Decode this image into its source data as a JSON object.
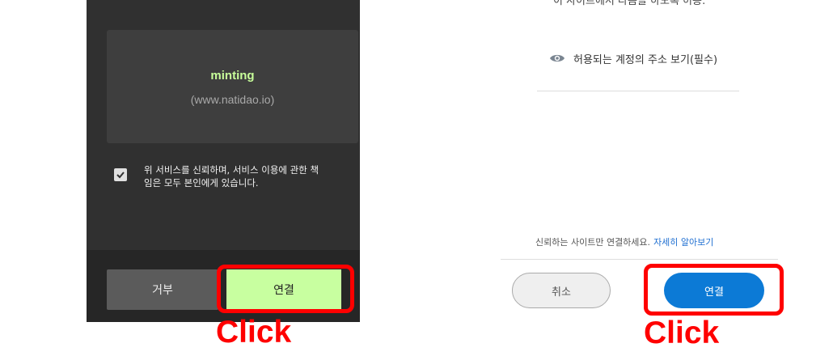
{
  "left_wallet": {
    "site_name": "minting",
    "site_url": "(www.natidao.io)",
    "consent_line1": "위 서비스를 신뢰하며, 서비스 이용에 관한 책",
    "consent_line2": "임은 모두 본인에게 있습니다.",
    "consent_checked": true,
    "reject_label": "거부",
    "connect_label": "연결",
    "click_label": "Click"
  },
  "right_wallet": {
    "top_text": "이 사이트에서 다음을 하도록 허용:",
    "permission": "허용되는 계정의 주소 보기(필수)",
    "trust_text": "신뢰하는 사이트만 연결하세요.",
    "trust_link": "자세히 알아보기",
    "cancel_label": "취소",
    "connect_label": "연결",
    "click_label": "Click"
  },
  "colors": {
    "accent_green": "#c8ffa0",
    "accent_blue": "#0c7ad6",
    "highlight_red": "#ff0000"
  }
}
